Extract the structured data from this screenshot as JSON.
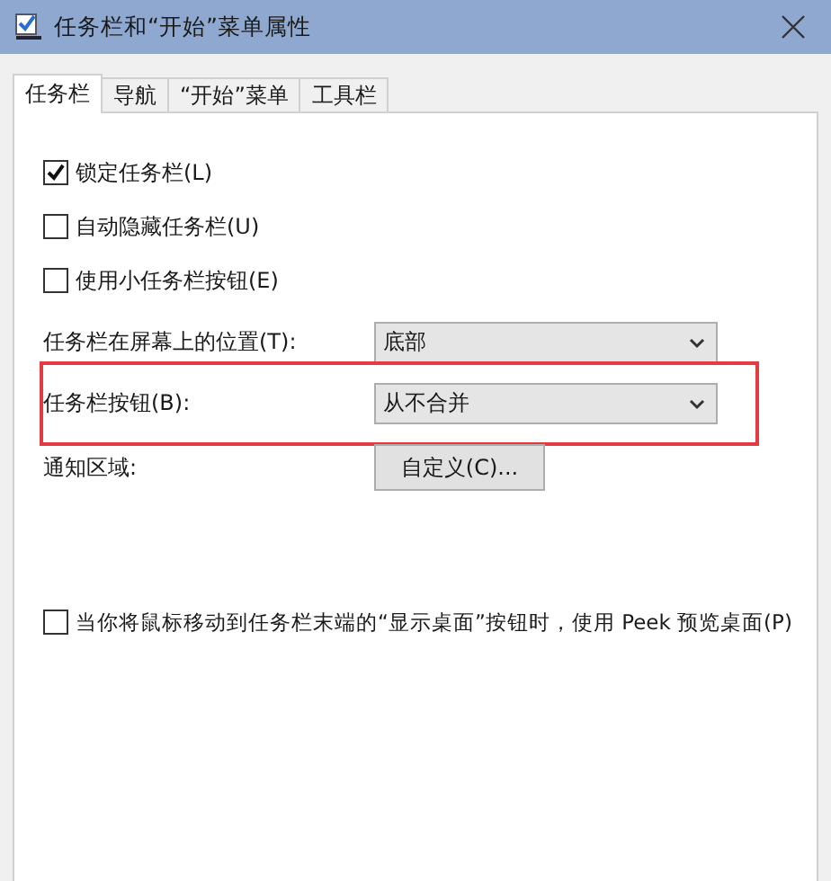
{
  "window": {
    "title": "任务栏和“开始”菜单属性"
  },
  "tabs": [
    {
      "label": "任务栏",
      "selected": true
    },
    {
      "label": "导航",
      "selected": false
    },
    {
      "label": "“开始”菜单",
      "selected": false
    },
    {
      "label": "工具栏",
      "selected": false
    }
  ],
  "options": [
    {
      "label": "锁定任务栏(L)",
      "checked": true
    },
    {
      "label": "自动隐藏任务栏(U)",
      "checked": false
    },
    {
      "label": "使用小任务栏按钮(E)",
      "checked": false
    }
  ],
  "settings": [
    {
      "kind": "dropdown",
      "label": "任务栏在屏幕上的位置(T):",
      "value": "底部",
      "highlighted": false
    },
    {
      "kind": "dropdown",
      "label": "任务栏按钮(B):",
      "value": "从不合并",
      "highlighted": true
    },
    {
      "kind": "button",
      "label": "通知区域:",
      "value": "自定义(C)...",
      "highlighted": false
    }
  ],
  "peek_option": {
    "label": "当你将鼠标移动到任务栏末端的“显示桌面”按钮时，使用 Peek 预览桌面(P)",
    "checked": false
  }
}
